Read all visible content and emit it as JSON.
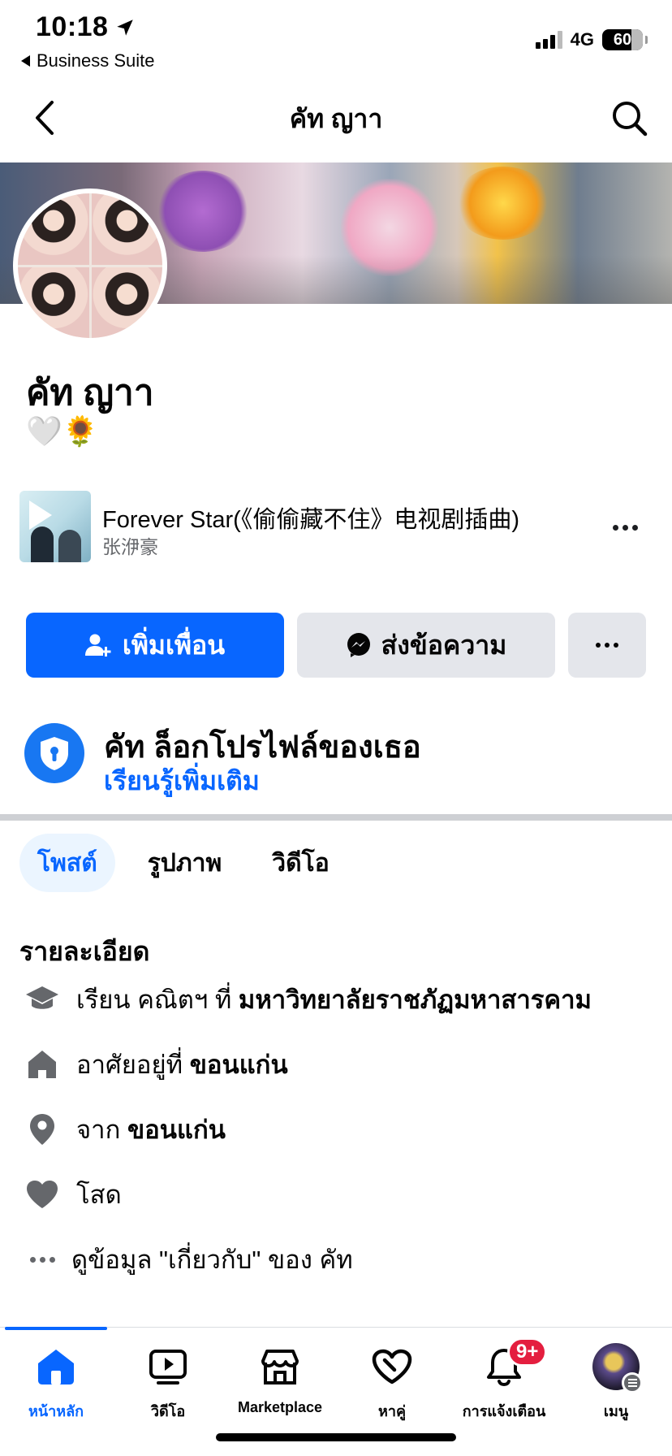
{
  "status_bar": {
    "time": "10:18",
    "back_app": "Business Suite",
    "network": "4G",
    "battery": "60"
  },
  "header": {
    "title": "คัท ญาา"
  },
  "profile": {
    "name": "คัท ญาา",
    "bio_emojis": "🤍🌻"
  },
  "music": {
    "song_title": "Forever Star(《偷偷藏不住》电视剧插曲)",
    "artist": "张洢豪"
  },
  "actions": {
    "add_friend": "เพิ่มเพื่อน",
    "message": "ส่งข้อความ"
  },
  "lock_notice": {
    "title": "คัท ล็อกโปรไฟล์ของเธอ",
    "link": "เรียนรู้เพิ่มเติม"
  },
  "tabs": [
    {
      "label": "โพสต์",
      "active": true
    },
    {
      "label": "รูปภาพ",
      "active": false
    },
    {
      "label": "วิดีโอ",
      "active": false
    }
  ],
  "details": {
    "title": "รายละเอียด",
    "education": {
      "prefix": "เรียน คณิตฯ ที่ ",
      "value": "มหาวิทยาลัยราชภัฏมหาสารคาม",
      "icon": "graduation-cap-icon"
    },
    "lives_in": {
      "prefix": "อาศัยอยู่ที่ ",
      "value": "ขอนแก่น",
      "icon": "home-icon"
    },
    "from": {
      "prefix": "จาก ",
      "value": "ขอนแก่น",
      "icon": "location-pin-icon"
    },
    "relationship": {
      "value": "โสด",
      "icon": "heart-icon"
    },
    "see_about": "ดูข้อมูล \"เกี่ยวกับ\" ของ คัท"
  },
  "bottom_nav": {
    "items": [
      {
        "label": "หน้าหลัก",
        "icon": "home-icon",
        "active": true
      },
      {
        "label": "วิดีโอ",
        "icon": "video-icon",
        "active": false
      },
      {
        "label": "Marketplace",
        "icon": "marketplace-icon",
        "active": false
      },
      {
        "label": "หาคู่",
        "icon": "dating-heart-icon",
        "active": false
      },
      {
        "label": "การแจ้งเตือน",
        "icon": "bell-icon",
        "active": false,
        "badge": "9+"
      },
      {
        "label": "เมนู",
        "icon": "menu-avatar",
        "active": false
      }
    ]
  },
  "colors": {
    "primary": "#0866ff",
    "badge": "#e41e3f",
    "button_gray": "#e4e6eb",
    "tab_active_bg": "#ebf5ff"
  }
}
